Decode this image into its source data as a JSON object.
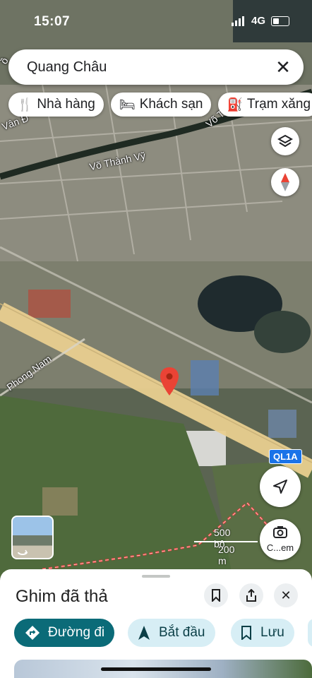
{
  "status_bar": {
    "time": "15:07",
    "network": "4G"
  },
  "search": {
    "query": "Quang Châu"
  },
  "chips": [
    {
      "icon": "restaurant-icon",
      "label": "Nhà hàng"
    },
    {
      "icon": "hotel-icon",
      "label": "Khách sạn"
    },
    {
      "icon": "gas-station-icon",
      "label": "Trạm xăng"
    }
  ],
  "map_labels": {
    "road_1": "Võ Thành Vỹ",
    "road_2": "Phong Nam",
    "road_3": "Vân Đ",
    "road_4": "Võ T",
    "road_5": "ồ",
    "highway": "QL1A"
  },
  "scale": {
    "imperial": "500 bộ",
    "metric": "200 m"
  },
  "camera": {
    "label": "C...em"
  },
  "sheet": {
    "title": "Ghim đã thả",
    "actions": [
      {
        "icon": "directions-icon",
        "label": "Đường đi"
      },
      {
        "icon": "navigation-arrow-icon",
        "label": "Bắt đầu"
      },
      {
        "icon": "bookmark-icon",
        "label": "Lưu"
      }
    ]
  },
  "colors": {
    "primary": "#0b6b78",
    "chip_bg": "#d7eef5",
    "pin": "#ea4335",
    "highway": "#e9cf8f"
  }
}
